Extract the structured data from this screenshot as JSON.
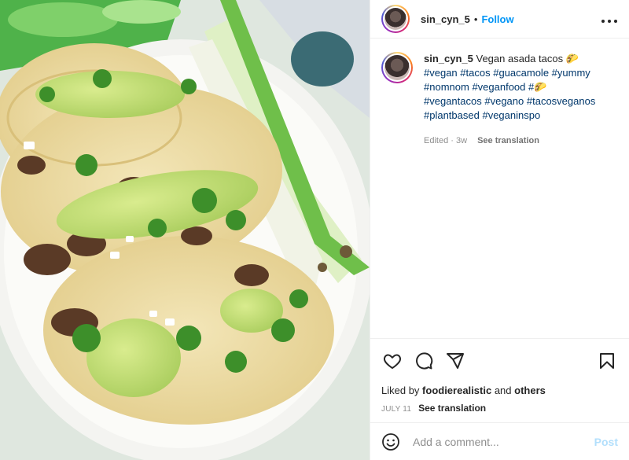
{
  "header": {
    "username": "sin_cyn_5",
    "separator": "•",
    "follow_label": "Follow",
    "more_label": "•••"
  },
  "caption": {
    "username": "sin_cyn_5",
    "text": "Vegan asada tacos",
    "emoji": "🌮",
    "hashtags_line1": [
      "#vegan",
      "#tacos",
      "#guacamole",
      "#yummy"
    ],
    "hashtags_line2": [
      "#nomnom",
      "#veganfood",
      "#"
    ],
    "emoji2": "🌮",
    "hashtags_line3": [
      "#vegantacos",
      "#vegano",
      "#tacosveganos"
    ],
    "hashtags_line4": [
      "#plantbased",
      "#veganinspo"
    ],
    "edited": "Edited · 3w",
    "see_translation": "See translation"
  },
  "actions": {
    "icons": [
      "heart-icon",
      "comment-icon",
      "share-icon",
      "bookmark-icon"
    ],
    "liked_by_prefix": "Liked by",
    "liked_by_user": "foodierealistic",
    "liked_by_and": "and",
    "liked_by_others": "others",
    "date": "JULY 11",
    "see_translation": "See translation"
  },
  "comment": {
    "placeholder": "Add a comment...",
    "post_label": "Post"
  },
  "colors": {
    "link": "#0095f6",
    "hashtag": "#00376b",
    "post_disabled": "#b2dffc",
    "muted": "#8e8e8e"
  }
}
